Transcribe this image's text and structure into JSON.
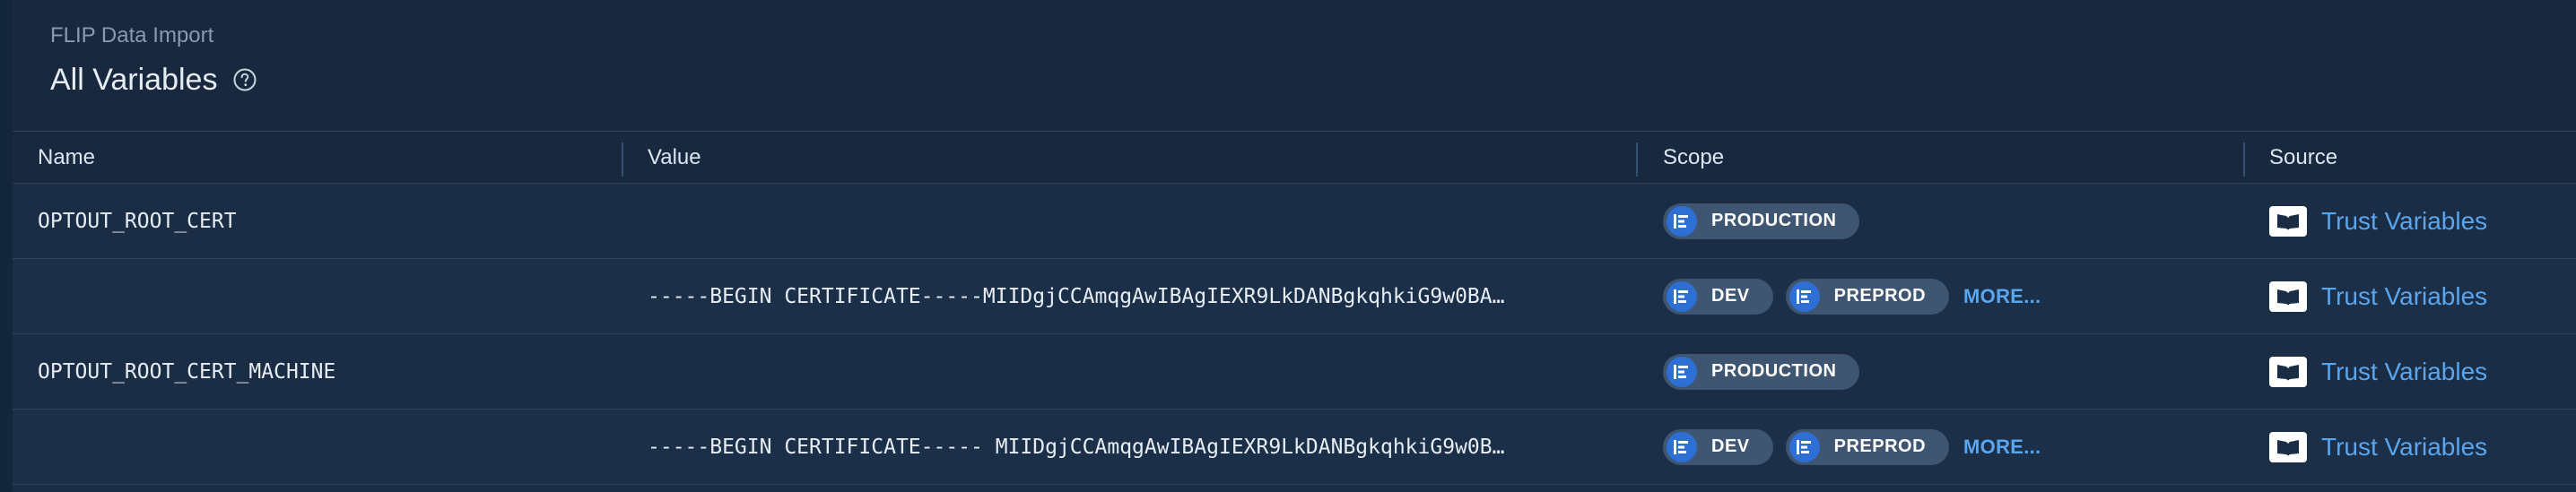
{
  "breadcrumb": "FLIP Data Import",
  "title": "All Variables",
  "icons": {
    "help": "help-circle-icon",
    "scope": "environment-icon",
    "source": "book-icon"
  },
  "colors": {
    "background": "#1a2d45",
    "accent": "#5aa6ee",
    "chip": "#3e5672",
    "chip_icon": "#2d6fd4"
  },
  "columns": {
    "name": "Name",
    "value": "Value",
    "scope": "Scope",
    "source": "Source"
  },
  "rows": [
    {
      "name": "OPTOUT_ROOT_CERT",
      "value": "",
      "scopes": [
        "PRODUCTION"
      ],
      "more": "",
      "source": "Trust Variables"
    },
    {
      "name": "",
      "value": "-----BEGIN CERTIFICATE-----MIIDgjCCAmqgAwIBAgIEXR9LkDANBgkqhkiG9w0BA…",
      "scopes": [
        "DEV",
        "PREPROD"
      ],
      "more": "MORE...",
      "source": "Trust Variables"
    },
    {
      "name": "OPTOUT_ROOT_CERT_MACHINE",
      "value": "",
      "scopes": [
        "PRODUCTION"
      ],
      "more": "",
      "source": "Trust Variables"
    },
    {
      "name": "",
      "value": "-----BEGIN CERTIFICATE----- MIIDgjCCAmqgAwIBAgIEXR9LkDANBgkqhkiG9w0B…",
      "scopes": [
        "DEV",
        "PREPROD"
      ],
      "more": "MORE...",
      "source": "Trust Variables"
    }
  ]
}
